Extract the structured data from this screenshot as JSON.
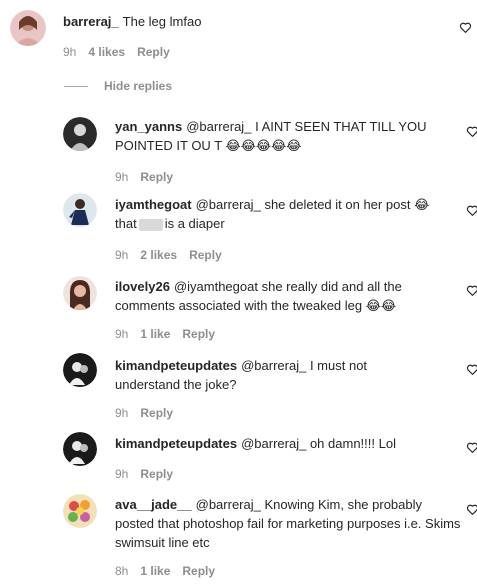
{
  "comments": [
    {
      "username": "barreraj_",
      "text": "The leg lmfao",
      "time": "9h",
      "likes": "4 likes",
      "reply": "Reply"
    }
  ],
  "hide_replies": "Hide replies",
  "replies": [
    {
      "username": "yan_yanns",
      "mention": "@barreraj_",
      "text": "I AINT SEEN THAT TILL YOU POINTED IT OU T",
      "emoji": "😂😂😂😂😂",
      "time": "9h",
      "reply": "Reply"
    },
    {
      "username": "iyamthegoat",
      "mention": "@barreraj_",
      "text_before": "she deleted it on her post",
      "emoji": "😂",
      "text_line2a": "that",
      "text_line2b": "is a diaper",
      "time": "9h",
      "likes": "2 likes",
      "reply": "Reply"
    },
    {
      "username": "ilovely26",
      "mention": "@iyamthegoat",
      "text": "she really did and all the comments associated with the tweaked leg",
      "emoji": "😂😂",
      "time": "9h",
      "likes": "1 like",
      "reply": "Reply"
    },
    {
      "username": "kimandpeteupdates",
      "mention": "@barreraj_",
      "text": "I must not understand the joke?",
      "time": "9h",
      "reply": "Reply"
    },
    {
      "username": "kimandpeteupdates",
      "mention": "@barreraj_",
      "text": "oh damn!!!! Lol",
      "time": "9h",
      "reply": "Reply"
    },
    {
      "username": "ava__jade__",
      "mention": "@barreraj_",
      "text": "Knowing Kim, she probably posted that photoshop fail for marketing purposes i.e. Skims swimsuit line etc",
      "time": "8h",
      "likes": "1 like",
      "reply": "Reply"
    }
  ],
  "icons": {
    "heart": "heart-outline-icon",
    "emoji": "face-with-tears-of-joy"
  },
  "colors": {
    "text": "#262626",
    "secondary": "#8e8e8e",
    "emoji": "#f7c325"
  }
}
